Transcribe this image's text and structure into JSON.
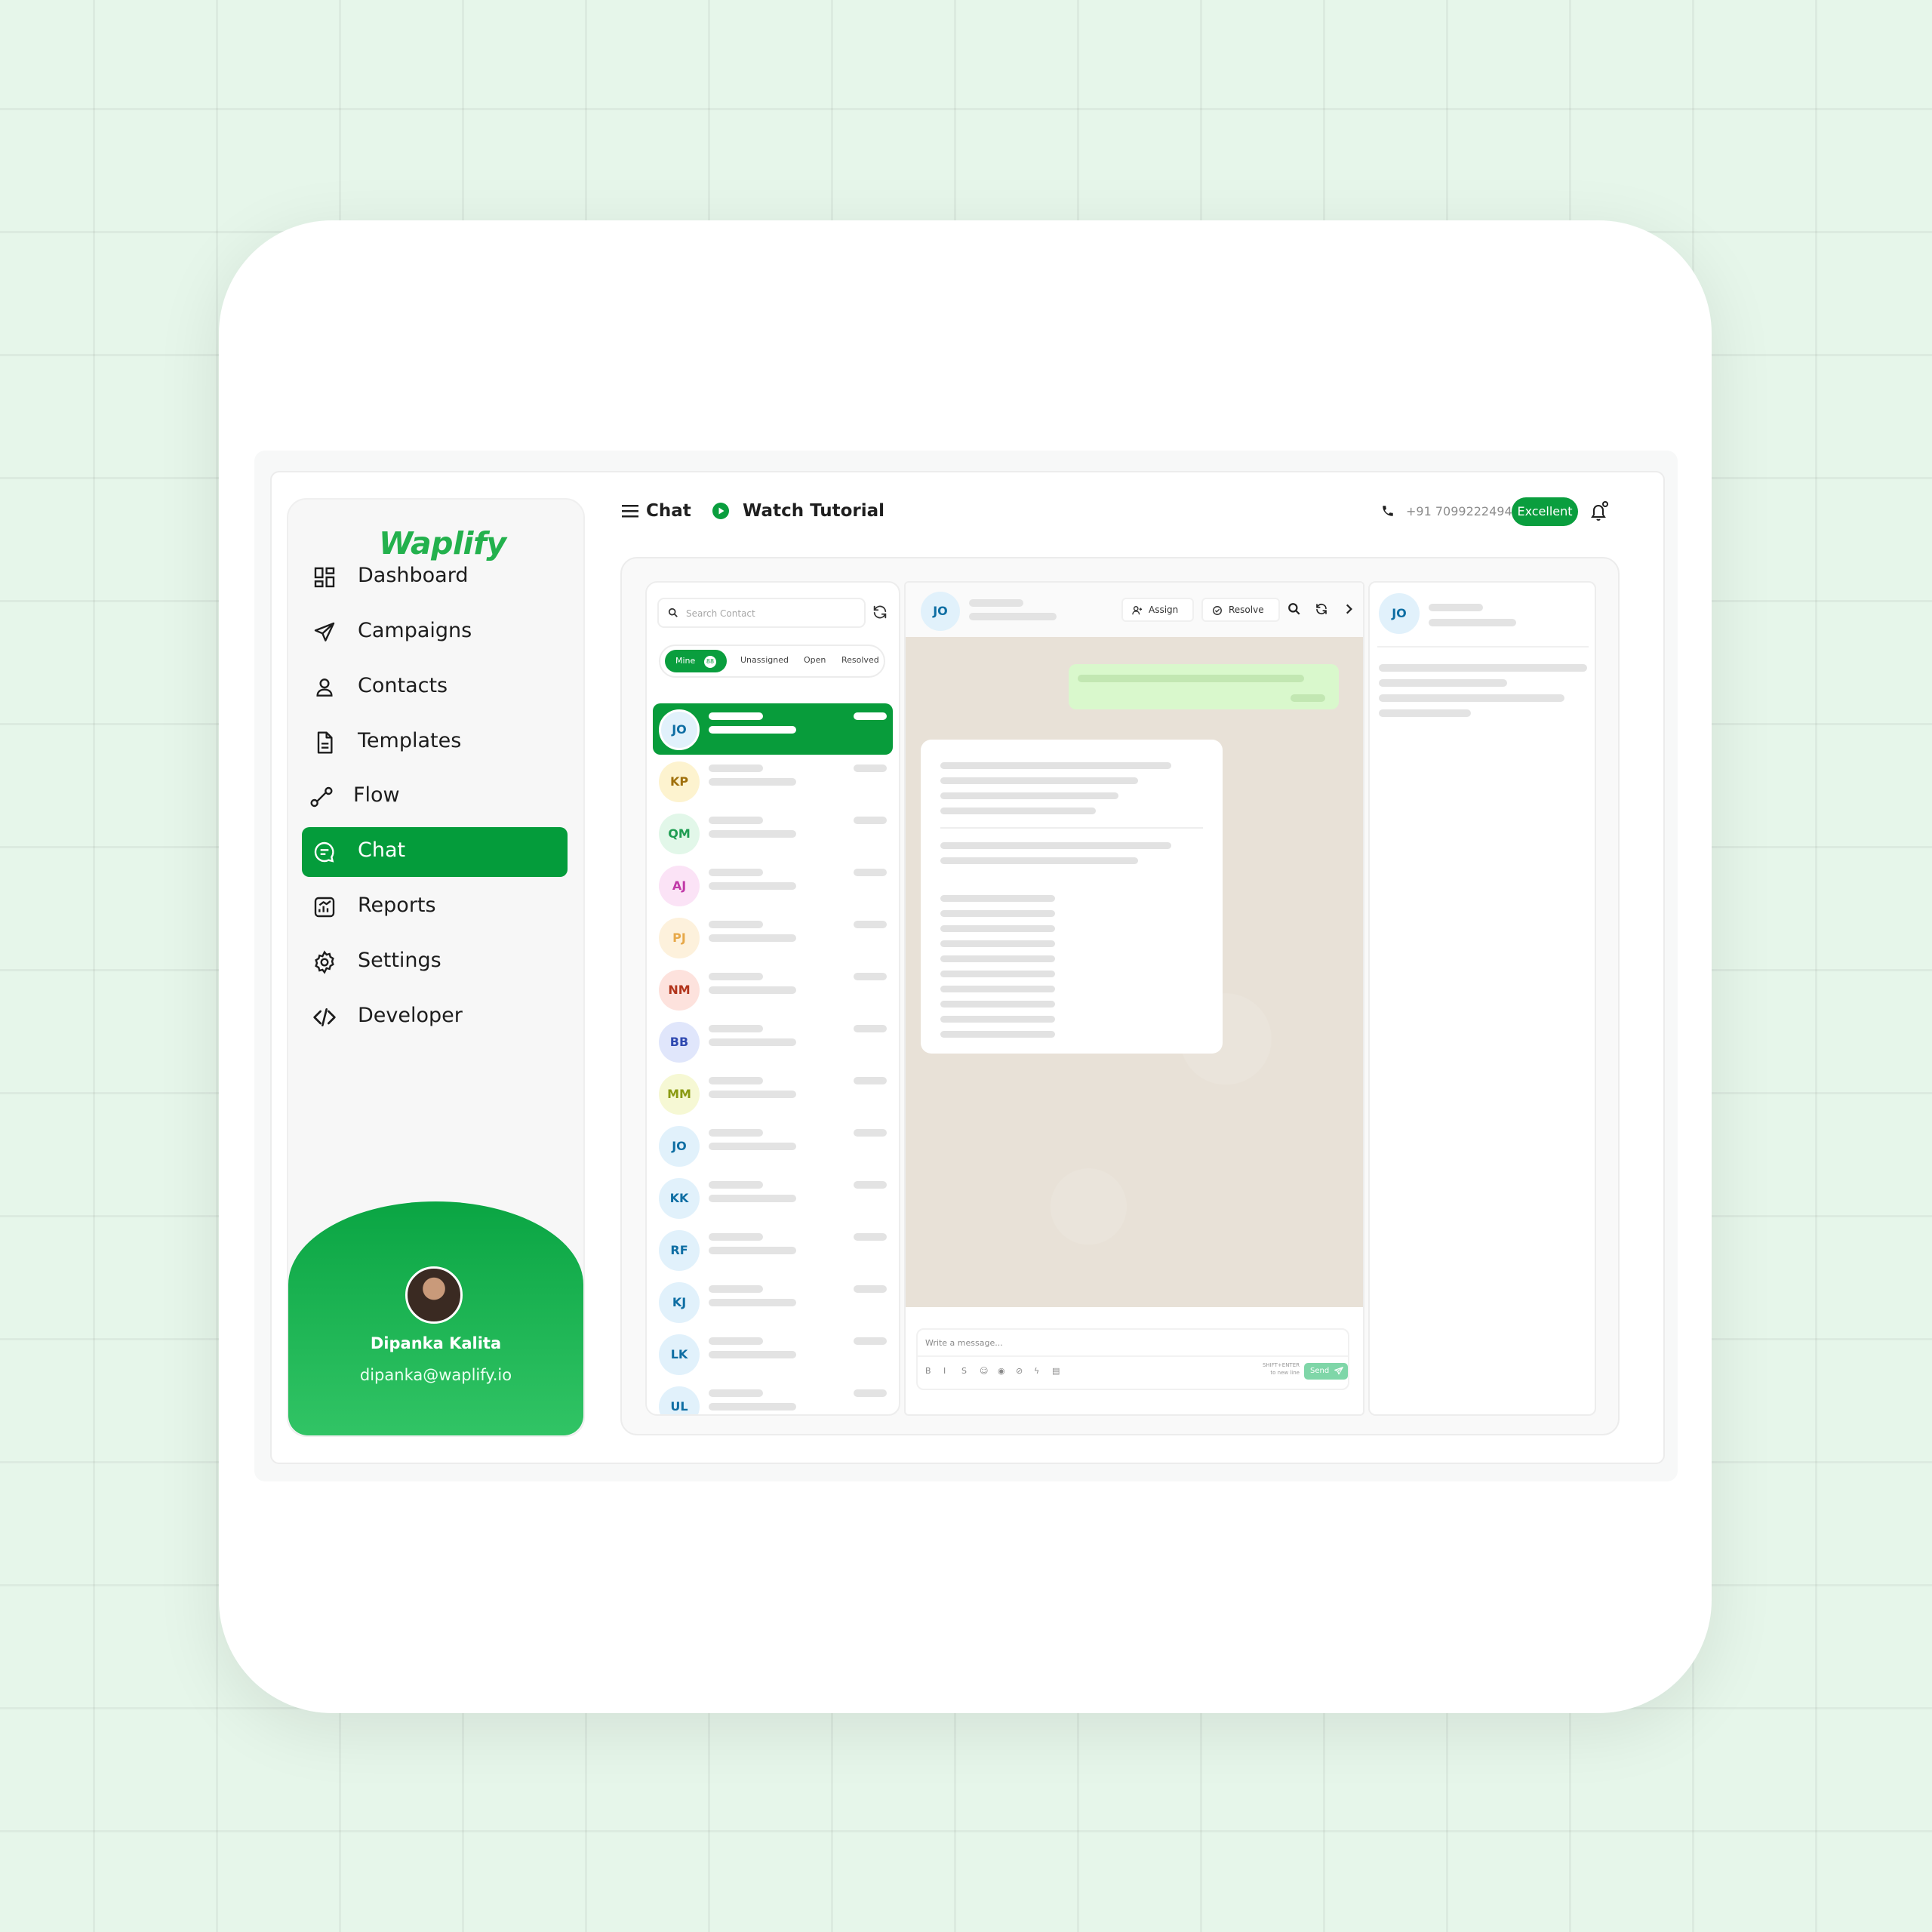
{
  "app": {
    "logo_text": "Waplify",
    "brand_color": "#049c3b"
  },
  "sidebar": {
    "items": [
      {
        "label": "Dashboard",
        "icon": "dashboard-icon",
        "active": false
      },
      {
        "label": "Campaigns",
        "icon": "send-icon",
        "active": false
      },
      {
        "label": "Contacts",
        "icon": "user-icon",
        "active": false
      },
      {
        "label": "Templates",
        "icon": "document-icon",
        "active": false
      },
      {
        "label": "Flow",
        "icon": "flow-icon",
        "active": false
      },
      {
        "label": "Chat",
        "icon": "chat-icon",
        "active": true
      },
      {
        "label": "Reports",
        "icon": "reports-icon",
        "active": false
      },
      {
        "label": "Settings",
        "icon": "gear-icon",
        "active": false
      },
      {
        "label": "Developer",
        "icon": "code-icon",
        "active": false
      }
    ],
    "profile": {
      "name": "Dipanka Kalita",
      "email": "dipanka@waplify.io"
    }
  },
  "header": {
    "title": "Chat",
    "watch_tutorial": "Watch Tutorial",
    "phone": "+91 7099222494",
    "quality_badge": "Excellent"
  },
  "contacts": {
    "search_placeholder": "Search Contact",
    "tabs": {
      "mine": "Mine",
      "mine_count": "88",
      "unassigned": "Unassigned",
      "open": "Open",
      "resolved": "Resolved"
    },
    "list": [
      {
        "initials": "JO",
        "bg": "#e1f1fb",
        "fg": "#0e6ea3"
      },
      {
        "initials": "KP",
        "bg": "#fdf3cf",
        "fg": "#a0700c"
      },
      {
        "initials": "QM",
        "bg": "#e2f7e9",
        "fg": "#1f9d52"
      },
      {
        "initials": "AJ",
        "bg": "#fbe3f6",
        "fg": "#c13aa8"
      },
      {
        "initials": "PJ",
        "bg": "#fdf1dc",
        "fg": "#e7a94a"
      },
      {
        "initials": "NM",
        "bg": "#fde2dd",
        "fg": "#b2341b"
      },
      {
        "initials": "BB",
        "bg": "#e0e6fb",
        "fg": "#2f49b0"
      },
      {
        "initials": "MM",
        "bg": "#f6f8d4",
        "fg": "#8a9a12"
      },
      {
        "initials": "JO",
        "bg": "#e1f1fb",
        "fg": "#0e6ea3"
      },
      {
        "initials": "KK",
        "bg": "#e1f1fb",
        "fg": "#0e6ea3"
      },
      {
        "initials": "RF",
        "bg": "#e1f1fb",
        "fg": "#0e6ea3"
      },
      {
        "initials": "KJ",
        "bg": "#e1f1fb",
        "fg": "#0e6ea3"
      },
      {
        "initials": "LK",
        "bg": "#e1f1fb",
        "fg": "#0e6ea3"
      },
      {
        "initials": "UL",
        "bg": "#e1f1fb",
        "fg": "#0e6ea3"
      }
    ]
  },
  "conversation": {
    "contact_initials": "JO",
    "assign_label": "Assign",
    "resolve_label": "Resolve",
    "composer_placeholder": "Write a message...",
    "format_buttons": [
      "B",
      "I",
      "S",
      "☺",
      "◉",
      "⊘",
      "ϟ",
      "▤"
    ],
    "shortcut_hint_line1": "SHIFT+ENTER",
    "shortcut_hint_line2": "to new line",
    "send_label": "Send"
  },
  "info": {
    "contact_initials": "JO"
  }
}
